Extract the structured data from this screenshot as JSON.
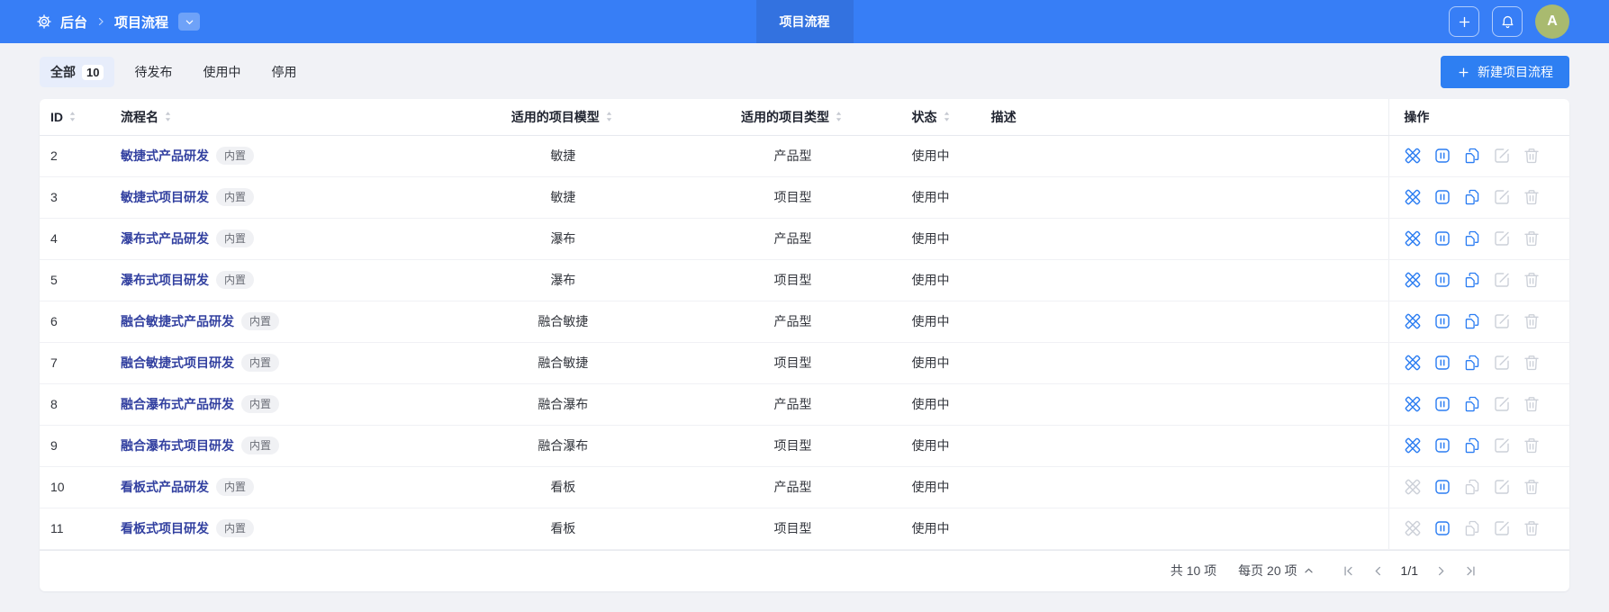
{
  "topbar": {
    "breadcrumb_root": "后台",
    "breadcrumb_current": "项目流程",
    "center_tab": "项目流程",
    "avatar": "A"
  },
  "toolbar": {
    "filter_tabs": [
      {
        "label": "全部",
        "count": "10",
        "active": true
      },
      {
        "label": "待发布",
        "active": false
      },
      {
        "label": "使用中",
        "active": false
      },
      {
        "label": "停用",
        "active": false
      }
    ],
    "create_button": "新建项目流程"
  },
  "table": {
    "columns": [
      {
        "key": "id",
        "label": "ID",
        "sortable": true,
        "align": "left"
      },
      {
        "key": "name",
        "label": "流程名",
        "sortable": true,
        "align": "left"
      },
      {
        "key": "model",
        "label": "适用的项目模型",
        "sortable": true,
        "align": "center"
      },
      {
        "key": "type",
        "label": "适用的项目类型",
        "sortable": true,
        "align": "center"
      },
      {
        "key": "status",
        "label": "状态",
        "sortable": true,
        "align": "left"
      },
      {
        "key": "desc",
        "label": "描述",
        "sortable": false,
        "align": "left"
      },
      {
        "key": "actions",
        "label": "操作",
        "sortable": false,
        "align": "left"
      }
    ],
    "badge_label": "内置",
    "action_order": [
      "design",
      "pause",
      "copy",
      "edit",
      "delete"
    ],
    "rows": [
      {
        "id": "2",
        "name": "敏捷式产品研发",
        "model": "敏捷",
        "type": "产品型",
        "status": "使用中",
        "desc": "",
        "actions": {
          "design": true,
          "pause": true,
          "copy": true,
          "edit": false,
          "delete": false
        }
      },
      {
        "id": "3",
        "name": "敏捷式项目研发",
        "model": "敏捷",
        "type": "项目型",
        "status": "使用中",
        "desc": "",
        "actions": {
          "design": true,
          "pause": true,
          "copy": true,
          "edit": false,
          "delete": false
        }
      },
      {
        "id": "4",
        "name": "瀑布式产品研发",
        "model": "瀑布",
        "type": "产品型",
        "status": "使用中",
        "desc": "",
        "actions": {
          "design": true,
          "pause": true,
          "copy": true,
          "edit": false,
          "delete": false
        }
      },
      {
        "id": "5",
        "name": "瀑布式项目研发",
        "model": "瀑布",
        "type": "项目型",
        "status": "使用中",
        "desc": "",
        "actions": {
          "design": true,
          "pause": true,
          "copy": true,
          "edit": false,
          "delete": false
        }
      },
      {
        "id": "6",
        "name": "融合敏捷式产品研发",
        "model": "融合敏捷",
        "type": "产品型",
        "status": "使用中",
        "desc": "",
        "actions": {
          "design": true,
          "pause": true,
          "copy": true,
          "edit": false,
          "delete": false
        }
      },
      {
        "id": "7",
        "name": "融合敏捷式项目研发",
        "model": "融合敏捷",
        "type": "项目型",
        "status": "使用中",
        "desc": "",
        "actions": {
          "design": true,
          "pause": true,
          "copy": true,
          "edit": false,
          "delete": false
        }
      },
      {
        "id": "8",
        "name": "融合瀑布式产品研发",
        "model": "融合瀑布",
        "type": "产品型",
        "status": "使用中",
        "desc": "",
        "actions": {
          "design": true,
          "pause": true,
          "copy": true,
          "edit": false,
          "delete": false
        }
      },
      {
        "id": "9",
        "name": "融合瀑布式项目研发",
        "model": "融合瀑布",
        "type": "项目型",
        "status": "使用中",
        "desc": "",
        "actions": {
          "design": true,
          "pause": true,
          "copy": true,
          "edit": false,
          "delete": false
        }
      },
      {
        "id": "10",
        "name": "看板式产品研发",
        "model": "看板",
        "type": "产品型",
        "status": "使用中",
        "desc": "",
        "actions": {
          "design": false,
          "pause": true,
          "copy": false,
          "edit": false,
          "delete": false
        }
      },
      {
        "id": "11",
        "name": "看板式项目研发",
        "model": "看板",
        "type": "项目型",
        "status": "使用中",
        "desc": "",
        "actions": {
          "design": false,
          "pause": true,
          "copy": false,
          "edit": false,
          "delete": false
        }
      }
    ]
  },
  "pagination": {
    "total": "共 10 项",
    "per_page": "每页 20 项",
    "page": "1/1"
  },
  "colors": {
    "topbar": "#377EF6",
    "topbar_active_tab": "#3372E0",
    "primary_button": "#2E7FF2",
    "link": "#3240A0",
    "action_enabled": "#2B7DF2",
    "action_disabled": "#CCD0D8",
    "avatar_bg": "#A9BA6F",
    "active_filter_bg": "#E7EDFB",
    "badge_bg": "#F0F1F4"
  }
}
